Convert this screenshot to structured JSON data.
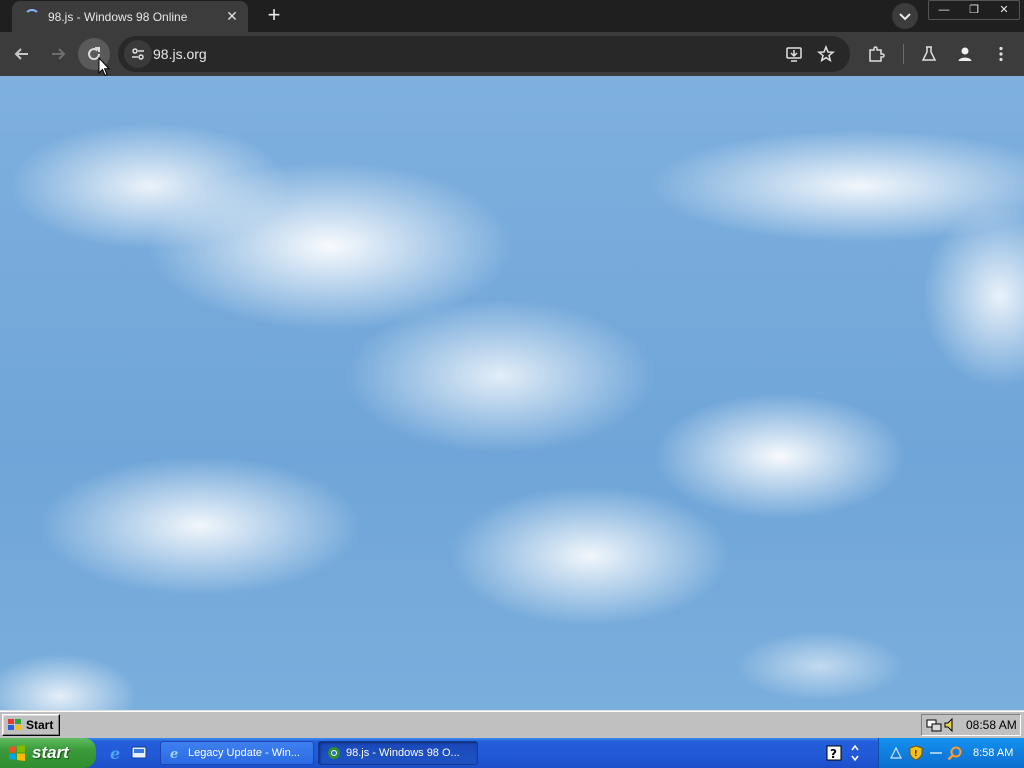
{
  "browser": {
    "tab": {
      "title": "98.js - Windows 98 Online"
    },
    "address": {
      "url": "98.js.org"
    }
  },
  "win98": {
    "start_label": "Start",
    "clock": "08:58 AM"
  },
  "xp": {
    "start_label": "start",
    "tasks": [
      {
        "label": "Legacy Update - Win..."
      },
      {
        "label": "98.js - Windows 98 O..."
      }
    ],
    "clock": "8:58 AM"
  },
  "colors": {
    "chrome_dark": "#1f1f1f",
    "chrome_toolbar": "#3c3c3c",
    "win98_gray": "#c0c0c0",
    "xp_blue": "#245edb",
    "xp_green": "#3a9b3a",
    "sky_blue": "#7fb0de"
  },
  "icons": {
    "tab": "loading-spinner-icon",
    "back": "arrow-left-icon",
    "forward": "arrow-right-icon",
    "reload": "reload-icon",
    "site_info": "tune-icon",
    "install": "install-app-icon",
    "bookmark": "star-icon",
    "extensions": "puzzle-icon",
    "labs": "flask-icon",
    "profile": "person-icon",
    "menu": "kebab-icon"
  }
}
